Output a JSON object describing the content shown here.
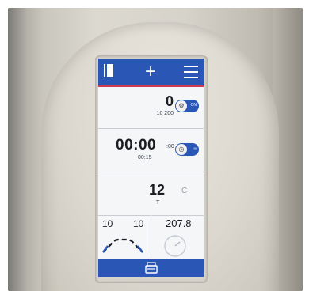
{
  "display": {
    "count": {
      "value": "0",
      "sub": "10 200",
      "toggle_label": "ON"
    },
    "timer": {
      "value": "00:00",
      "small": ":00",
      "sub": "00:15",
      "toggle_label": "∞"
    },
    "temperature": {
      "value": "12",
      "unit": "C",
      "sub": "T"
    },
    "ramp": {
      "left": "10",
      "right": "10"
    },
    "speed": {
      "value": "207.8"
    }
  },
  "colors": {
    "accent": "#2a56b6",
    "divider": "#d03a50"
  },
  "icons": [
    "book-icon",
    "plus-icon",
    "menu-icon",
    "rotor-icon",
    "timer-icon",
    "lid-icon"
  ]
}
